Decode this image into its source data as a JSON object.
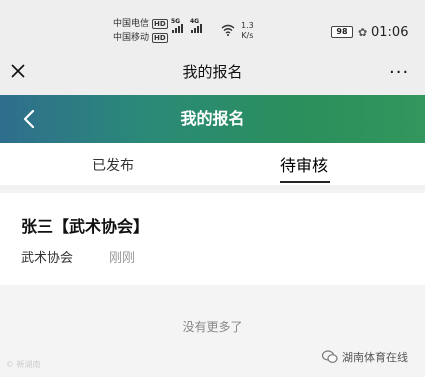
{
  "status_bar": {
    "carrier_1": "中国电信",
    "carrier_2": "中国移动",
    "hd_badge": "HD",
    "net_1": "5G",
    "net_2": "4G",
    "speed_value": "1.3",
    "speed_unit": "K/s",
    "battery": "98",
    "time": "01:06",
    "icons": [
      "signal-icon",
      "wifi-icon",
      "battery-icon",
      "leaf-icon"
    ]
  },
  "app_bar": {
    "title": "我的报名",
    "close_icon": "close-icon",
    "more_label": "···"
  },
  "page_header": {
    "title": "我的报名",
    "back_icon": "chevron-left-icon",
    "gradient_colors": [
      "#2f6e8e",
      "#2a8a77",
      "#32965d"
    ]
  },
  "tabs": [
    {
      "label": "已发布",
      "active": false
    },
    {
      "label": "待审核",
      "active": true
    }
  ],
  "list": {
    "items": [
      {
        "title": "张三【武术协会】",
        "organization": "武术协会",
        "time": "刚刚"
      }
    ],
    "end_text": "没有更多了"
  },
  "watermark": {
    "left_text": "© 新湖南",
    "right_text": "湖南体育在线"
  }
}
